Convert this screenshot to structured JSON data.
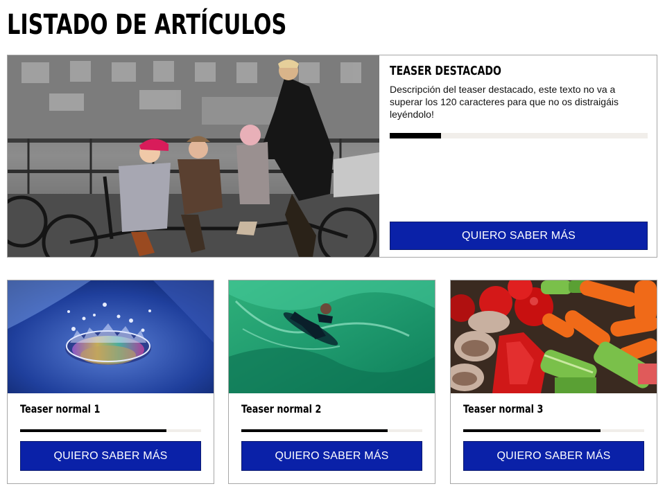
{
  "page": {
    "title": "LISTADO DE ARTÍCULOS"
  },
  "featured": {
    "image_alt": "family on tandem bicycle",
    "title": "TEASER DESTACADO",
    "description": "Descripción del teaser destacado, este texto no va a superar los 120 caracteres para que no os distraigáis leyéndolo!",
    "progress": 0.2,
    "cta_label": "QUIERO SABER MÁS"
  },
  "cards": [
    {
      "image_alt": "water drop splash",
      "title": "Teaser normal 1",
      "progress": 0.81,
      "cta_label": "QUIERO SABER MÁS"
    },
    {
      "image_alt": "bodyboarder on green wave",
      "title": "Teaser normal 2",
      "progress": 0.81,
      "cta_label": "QUIERO SABER MÁS"
    },
    {
      "image_alt": "vegetables close-up",
      "title": "Teaser normal 3",
      "progress": 0.76,
      "cta_label": "QUIERO SABER MÁS"
    }
  ],
  "colors": {
    "cta_background": "#0a21a8",
    "progress_fill": "#000000",
    "progress_track": "#f1eeea",
    "border": "#a6a6a6"
  }
}
